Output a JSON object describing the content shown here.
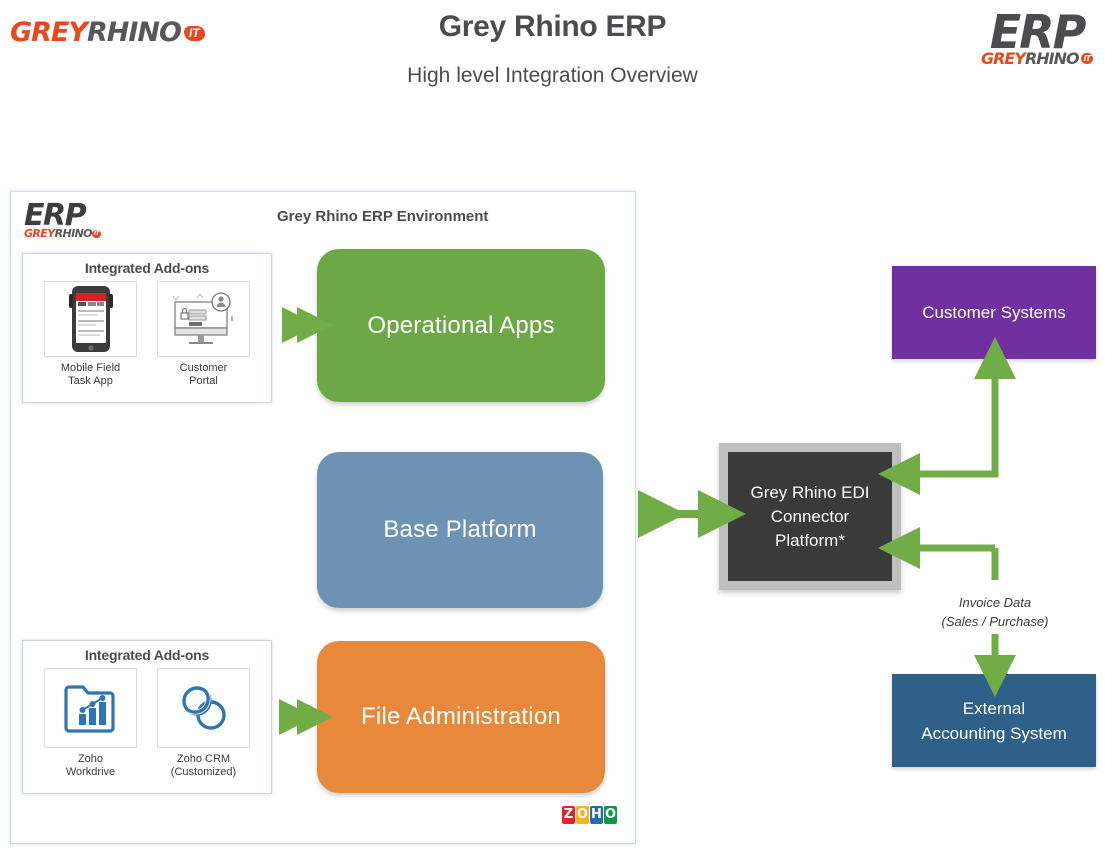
{
  "header": {
    "title": "Grey Rhino ERP",
    "subtitle": "High level Integration Overview",
    "logo_left": {
      "word1": "GREY",
      "word2": "RHINO",
      "badge": "IT"
    },
    "logo_right": {
      "main": "ERP",
      "sub1": "GREY",
      "sub2": "RHINO",
      "badge": "IT"
    }
  },
  "environment": {
    "title": "Grey Rhino ERP Environment",
    "logo": {
      "main": "ERP",
      "sub1": "GREY",
      "sub2": "RHINO",
      "badge": "IT"
    },
    "addons_top": {
      "heading": "Integrated Add-ons",
      "items": [
        {
          "label_line1": "Mobile Field",
          "label_line2": "Task App",
          "icon": "rugged-smartphone-icon"
        },
        {
          "label_line1": "Customer",
          "label_line2": "Portal",
          "icon": "desktop-login-icon"
        }
      ]
    },
    "addons_bottom": {
      "heading": "Integrated Add-ons",
      "items": [
        {
          "label_line1": "Zoho",
          "label_line2": "Workdrive",
          "icon": "folder-chart-icon"
        },
        {
          "label_line1": "Zoho CRM",
          "label_line2": "(Customized)",
          "icon": "linked-rings-icon"
        }
      ]
    },
    "panels": [
      {
        "label": "Operational Apps",
        "color": "#6DA847"
      },
      {
        "label": "Base Platform",
        "color": "#6E92B4"
      },
      {
        "label": "File Administration",
        "color": "#E8883A"
      }
    ],
    "vendor_logo": {
      "l1": "Z",
      "l2": "O",
      "l3": "H",
      "l4": "O"
    }
  },
  "external": {
    "edi": {
      "line1": "Grey Rhino EDI",
      "line2": "Connector",
      "line3": "Platform*",
      "color": "#3A3A3A"
    },
    "customer_systems": {
      "label": "Customer Systems",
      "color": "#7030A0"
    },
    "accounting": {
      "line1": "External",
      "line2": "Accounting System",
      "color": "#2E6089"
    },
    "flow_label": {
      "line1": "Invoice Data",
      "line2": "(Sales / Purchase)"
    }
  },
  "colors": {
    "arrow_green": "#70AD47",
    "text_dark": "#4C4C4E",
    "brand_orange": "#E8481C"
  }
}
